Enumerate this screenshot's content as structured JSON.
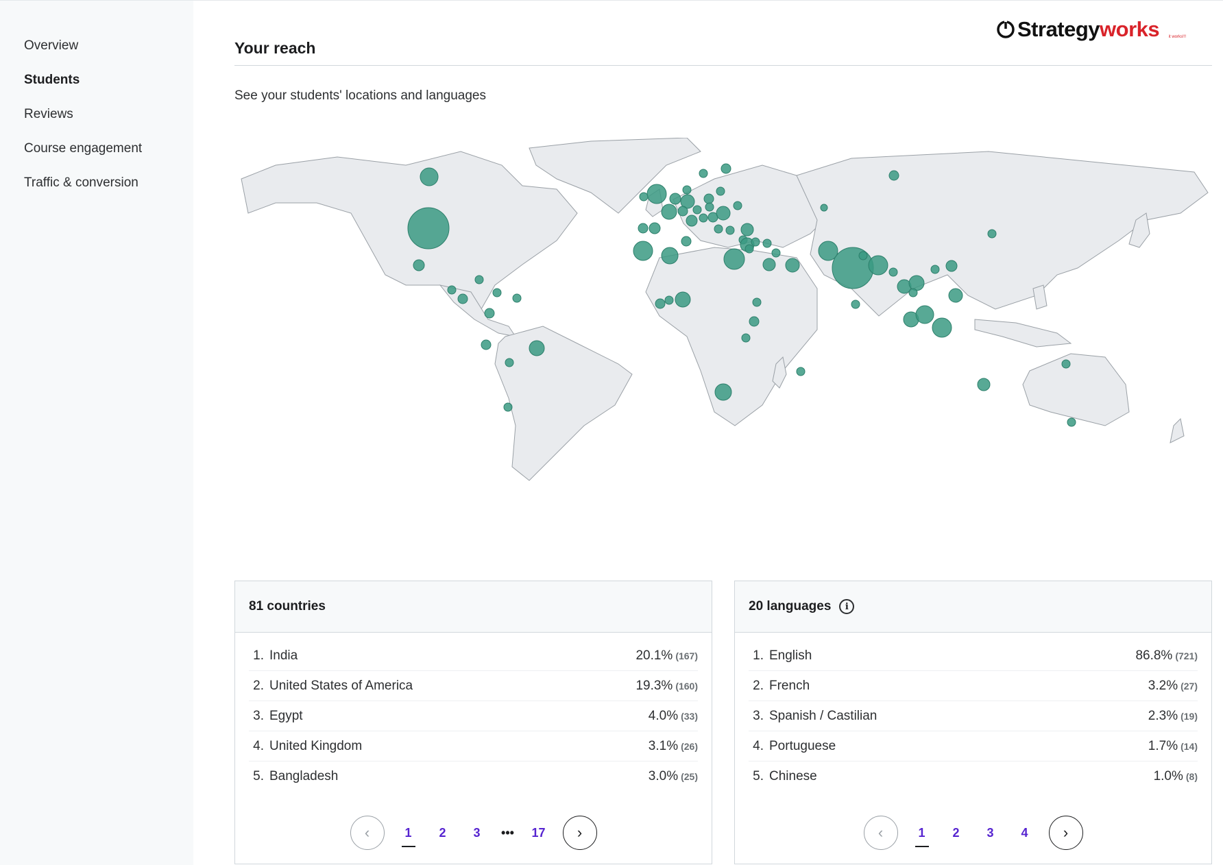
{
  "sidebar": {
    "items": [
      {
        "label": "Overview",
        "active": false
      },
      {
        "label": "Students",
        "active": true
      },
      {
        "label": "Reviews",
        "active": false
      },
      {
        "label": "Course engagement",
        "active": false
      },
      {
        "label": "Traffic & conversion",
        "active": false
      }
    ]
  },
  "logo": {
    "part1": "Strategy",
    "part2": "works",
    "tagline": "it works!!!"
  },
  "header": {
    "title": "Your reach",
    "subtitle": "See your students' locations and languages"
  },
  "map": {
    "marker_color": "#3b9a83",
    "land_color": "#e9ebee",
    "border_color": "#9aa0a6"
  },
  "countries_card": {
    "title": "81 countries",
    "rows": [
      {
        "rank": "1.",
        "name": "India",
        "pct": "20.1%",
        "count": "(167)"
      },
      {
        "rank": "2.",
        "name": "United States of America",
        "pct": "19.3%",
        "count": "(160)"
      },
      {
        "rank": "3.",
        "name": "Egypt",
        "pct": "4.0%",
        "count": "(33)"
      },
      {
        "rank": "4.",
        "name": "United Kingdom",
        "pct": "3.1%",
        "count": "(26)"
      },
      {
        "rank": "5.",
        "name": "Bangladesh",
        "pct": "3.0%",
        "count": "(25)"
      }
    ],
    "pages": [
      "1",
      "2",
      "3",
      "17"
    ],
    "current_page": "1"
  },
  "languages_card": {
    "title": "20 languages",
    "rows": [
      {
        "rank": "1.",
        "name": "English",
        "pct": "86.8%",
        "count": "(721)"
      },
      {
        "rank": "2.",
        "name": "French",
        "pct": "3.2%",
        "count": "(27)"
      },
      {
        "rank": "3.",
        "name": "Spanish / Castilian",
        "pct": "2.3%",
        "count": "(19)"
      },
      {
        "rank": "4.",
        "name": "Portuguese",
        "pct": "1.7%",
        "count": "(14)"
      },
      {
        "rank": "5.",
        "name": "Chinese",
        "pct": "1.0%",
        "count": "(8)"
      }
    ],
    "pages": [
      "1",
      "2",
      "3",
      "4"
    ],
    "current_page": "1"
  }
}
